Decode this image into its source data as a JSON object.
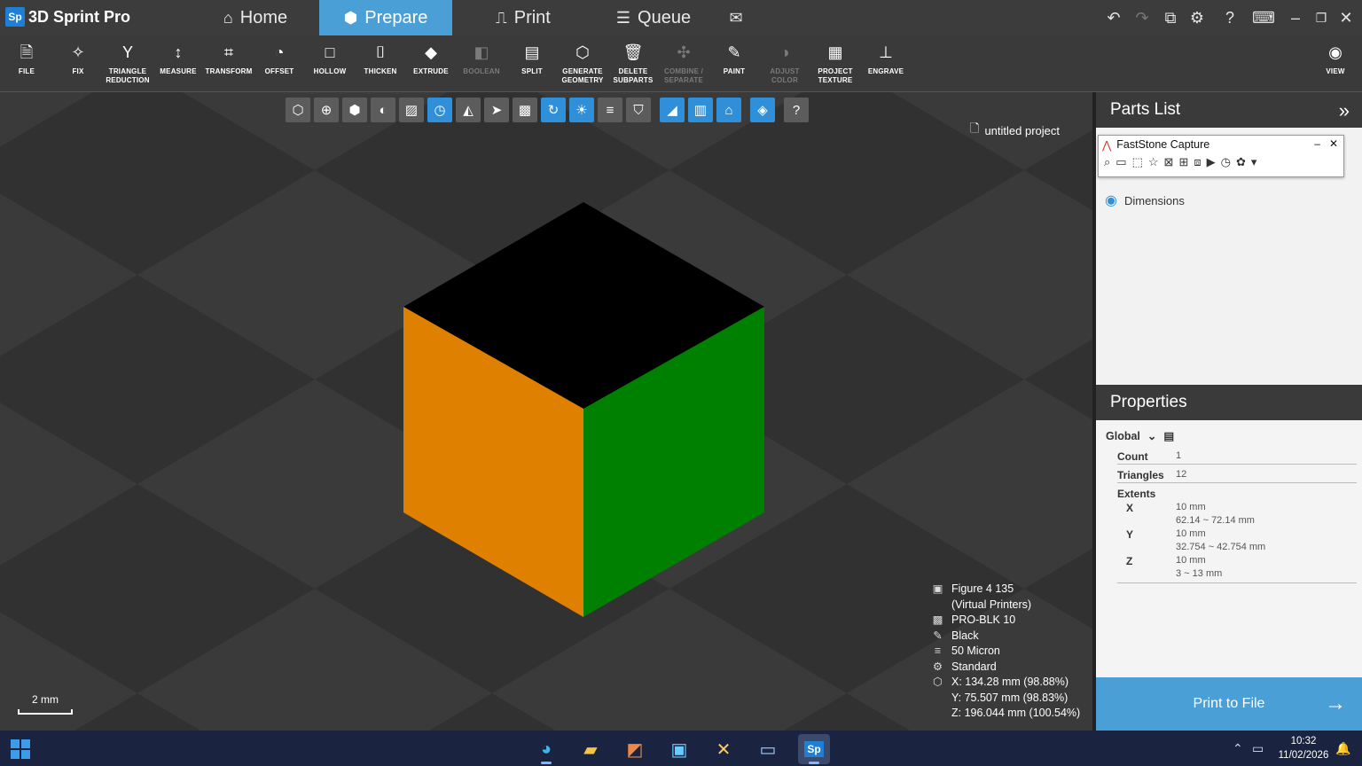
{
  "app": {
    "logo": "Sp",
    "title": "3D Sprint Pro"
  },
  "nav_tabs": [
    {
      "label": "Home",
      "icon": "home-icon",
      "active": false
    },
    {
      "label": "Prepare",
      "icon": "cube-icon",
      "active": true
    },
    {
      "label": "Print",
      "icon": "printer-icon",
      "active": false
    },
    {
      "label": "Queue",
      "icon": "queue-icon",
      "active": false
    }
  ],
  "ribbon": [
    {
      "label": "FILE",
      "icon": "file-icon"
    },
    {
      "label": "FIX",
      "icon": "fix-icon"
    },
    {
      "label": "TRIANGLE\nREDUCTION",
      "icon": "triangle-reduction-icon"
    },
    {
      "label": "MEASURE",
      "icon": "measure-icon"
    },
    {
      "label": "TRANSFORM",
      "icon": "transform-icon"
    },
    {
      "label": "OFFSET",
      "icon": "offset-icon"
    },
    {
      "label": "HOLLOW",
      "icon": "hollow-icon"
    },
    {
      "label": "THICKEN",
      "icon": "thicken-icon"
    },
    {
      "label": "EXTRUDE",
      "icon": "extrude-icon"
    },
    {
      "label": "BOOLEAN",
      "icon": "boolean-icon",
      "disabled": true
    },
    {
      "label": "SPLIT",
      "icon": "split-icon"
    },
    {
      "label": "GENERATE\nGEOMETRY",
      "icon": "generate-geometry-icon"
    },
    {
      "label": "DELETE\nSUBPARTS",
      "icon": "trash-icon"
    },
    {
      "label": "COMBINE /\nSEPARATE",
      "icon": "combine-icon",
      "disabled": true
    },
    {
      "label": "PAINT",
      "icon": "brush-icon"
    },
    {
      "label": "ADJUST\nCOLOR",
      "icon": "adjust-color-icon",
      "disabled": true
    },
    {
      "label": "PROJECT\nTEXTURE",
      "icon": "texture-icon"
    },
    {
      "label": "ENGRAVE",
      "icon": "engrave-icon"
    }
  ],
  "view_button": {
    "label": "VIEW",
    "icon": "eye-icon"
  },
  "viewport": {
    "project_name": "untitled project",
    "scale_label": "2 mm",
    "info": [
      {
        "icon": "printer-icon",
        "text": "Figure 4 135"
      },
      {
        "icon": "",
        "text": "(Virtual Printers)"
      },
      {
        "icon": "material-icon",
        "text": "PRO-BLK 10"
      },
      {
        "icon": "color-icon",
        "text": "Black"
      },
      {
        "icon": "layer-icon",
        "text": "50 Micron"
      },
      {
        "icon": "gear-icon",
        "text": "Standard"
      },
      {
        "icon": "box-icon",
        "text": "X:  134.28 mm (98.88%)"
      },
      {
        "icon": "",
        "text": "Y:  75.507 mm (98.83%)"
      },
      {
        "icon": "",
        "text": "Z:  196.044 mm (100.54%)"
      }
    ],
    "cube_colors": {
      "top": "#000000",
      "left": "#e08000",
      "right": "#008000"
    }
  },
  "parts_list": {
    "title": "Parts List",
    "items": [
      {
        "label": "Dimensions",
        "icon": "eye-icon"
      }
    ]
  },
  "faststone": {
    "title": "FastStone Capture"
  },
  "properties": {
    "title": "Properties",
    "scope": "Global",
    "count_label": "Count",
    "count": "1",
    "triangles_label": "Triangles",
    "triangles": "12",
    "extents_label": "Extents",
    "extents": [
      {
        "axis": "X",
        "size": "10 mm",
        "range": "62.14 ~ 72.14 mm"
      },
      {
        "axis": "Y",
        "size": "10 mm",
        "range": "32.754 ~ 42.754 mm"
      },
      {
        "axis": "Z",
        "size": "10 mm",
        "range": "3 ~ 13 mm"
      }
    ]
  },
  "print_button": "Print to File",
  "taskbar": {
    "time": "10:32",
    "date": "11/02/2026"
  },
  "colors": {
    "accent": "#4a9fd6",
    "active_tool": "#2f8fd8"
  }
}
